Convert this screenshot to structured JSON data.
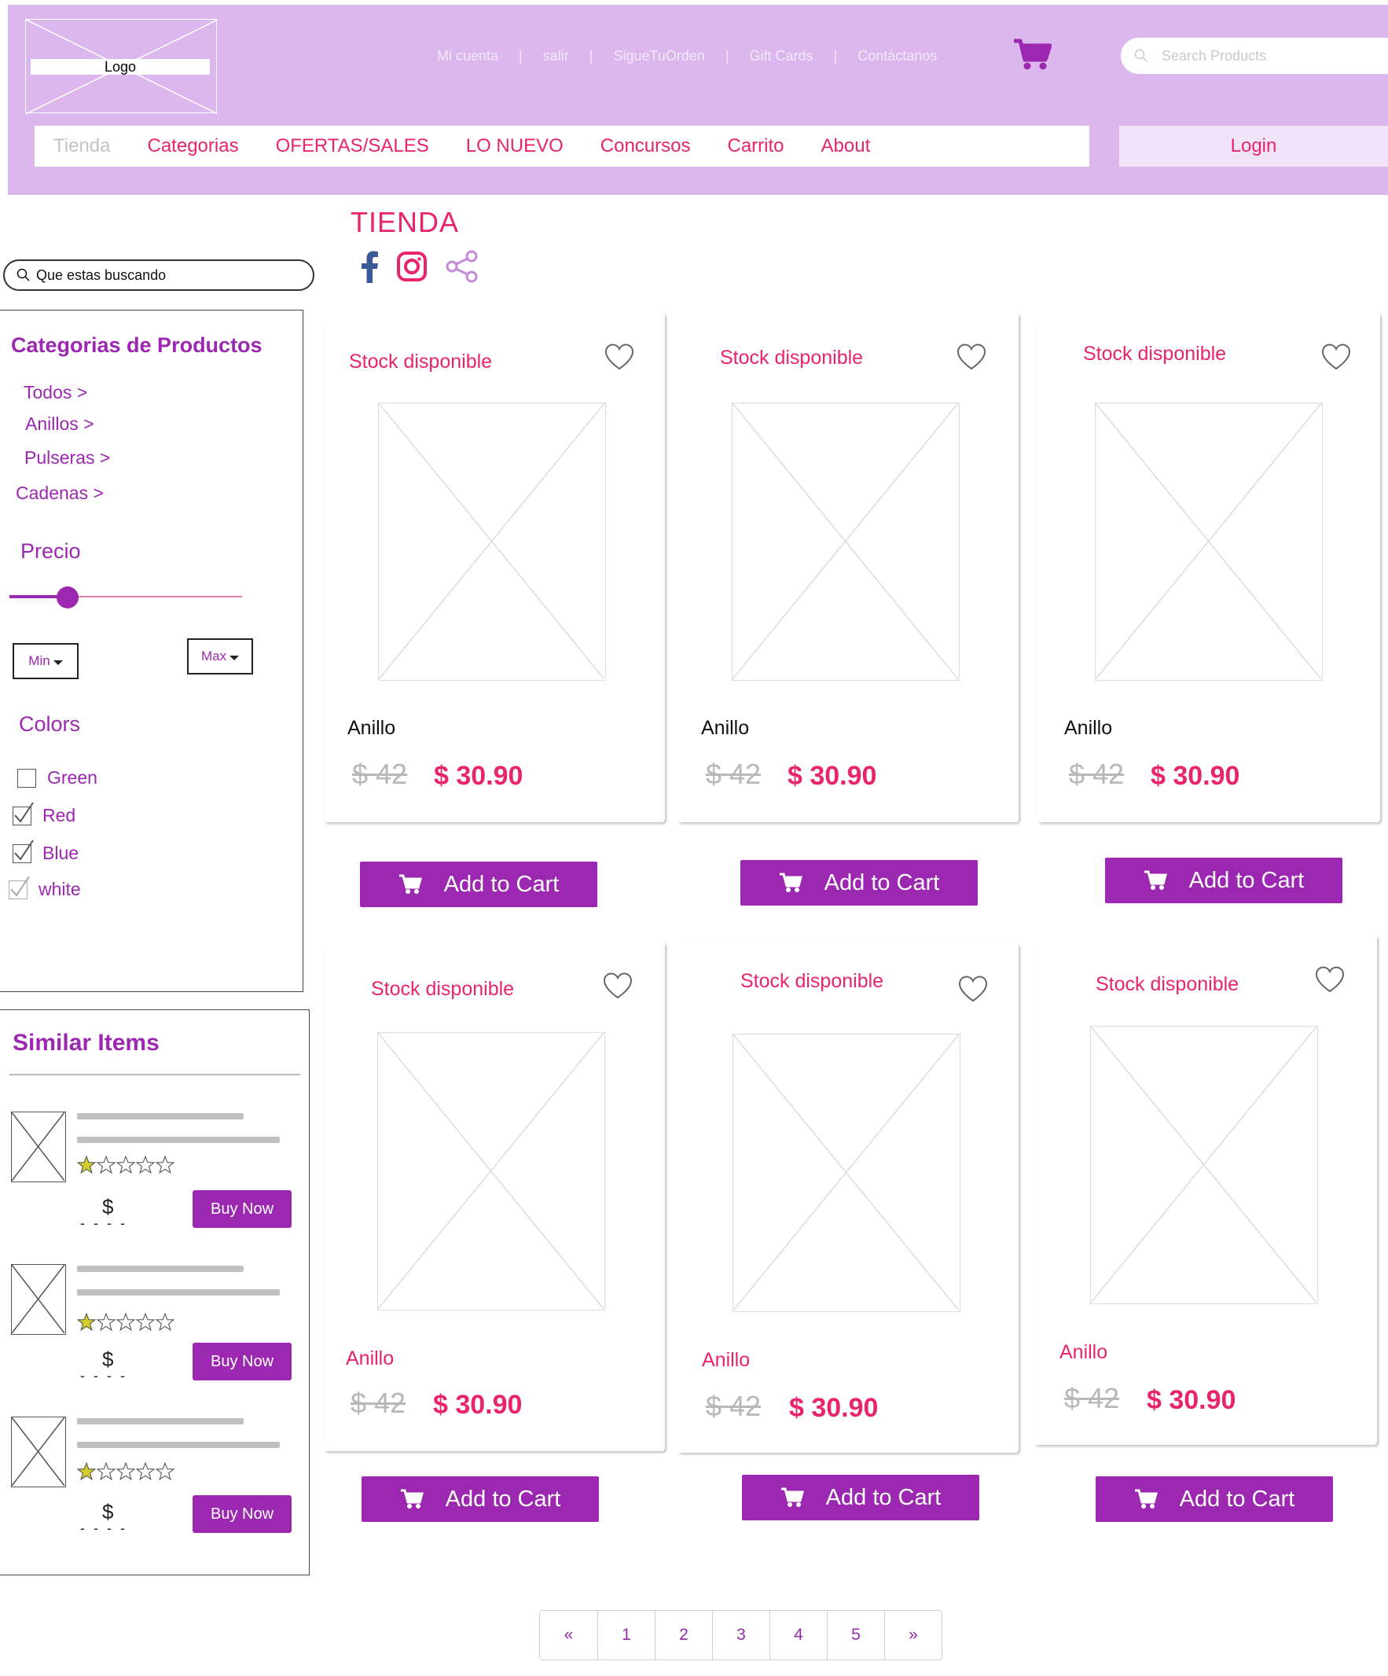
{
  "header": {
    "logo_label": "Logo",
    "top_links": [
      "Mi cuenta",
      "salir",
      "SigueTuOrden",
      "Gift Cards",
      "Contáctanos"
    ],
    "top_sep": "|",
    "search_placeholder": "Search Products",
    "nav": [
      "Tienda",
      "Categorias",
      "OFERTAS/SALES",
      "LO NUEVO",
      "Concursos",
      "Carrito",
      "About"
    ],
    "login_label": "Login"
  },
  "page": {
    "title": "TIENDA"
  },
  "sidebar": {
    "search_placeholder": "Que estas buscando",
    "categories_title": "Categorias de Productos",
    "categories": [
      "Todos >",
      "Anillos >",
      "Pulseras >",
      "Cadenas >"
    ],
    "price_title": "Precio",
    "price_slider_fraction": 0.25,
    "min_label": "Min",
    "max_label": "Max",
    "colors_title": "Colors",
    "colors": [
      {
        "label": "Green",
        "checked": false
      },
      {
        "label": "Red",
        "checked": true
      },
      {
        "label": "Blue",
        "checked": true
      },
      {
        "label": "white",
        "checked": true
      }
    ],
    "similar_title": "Similar Items",
    "similar_items": [
      {
        "price_symbol": "$",
        "price_dashes": "- - - -",
        "rating": 1,
        "rating_max": 5,
        "button": "Buy Now"
      },
      {
        "price_symbol": "$",
        "price_dashes": "- - - -",
        "rating": 1,
        "rating_max": 5,
        "button": "Buy Now"
      },
      {
        "price_symbol": "$",
        "price_dashes": "- - - -",
        "rating": 1,
        "rating_max": 5,
        "button": "Buy Now"
      }
    ]
  },
  "products": [
    {
      "stock": "Stock disponible",
      "name": "Anillo",
      "old_price": "$ 42",
      "price": "$ 30.90",
      "button": "Add to Cart"
    },
    {
      "stock": "Stock disponible",
      "name": "Anillo",
      "old_price": "$ 42",
      "price": "$ 30.90",
      "button": "Add to Cart"
    },
    {
      "stock": "Stock disponible",
      "name": "Anillo",
      "old_price": "$ 42",
      "price": "$ 30.90",
      "button": "Add to Cart"
    },
    {
      "stock": "Stock disponible",
      "name": "Anillo",
      "old_price": "$ 42",
      "price": "$ 30.90",
      "button": "Add to Cart"
    },
    {
      "stock": "Stock disponible",
      "name": "Anillo",
      "old_price": "$ 42",
      "price": "$ 30.90",
      "button": "Add to Cart"
    },
    {
      "stock": "Stock disponible",
      "name": "Anillo",
      "old_price": "$ 42",
      "price": "$ 30.90",
      "button": "Add to Cart"
    }
  ],
  "pagination": [
    "«",
    "1",
    "2",
    "3",
    "4",
    "5",
    "»"
  ],
  "colors": {
    "header_bg": "#dcb7ee",
    "accent_purple": "#9c27b0",
    "accent_pink": "#e8246c"
  },
  "icons": {
    "cart": "cart-icon",
    "search": "search-icon",
    "facebook": "facebook-icon",
    "instagram": "instagram-icon",
    "share": "share-icon",
    "heart": "heart-icon",
    "star": "star-icon"
  }
}
